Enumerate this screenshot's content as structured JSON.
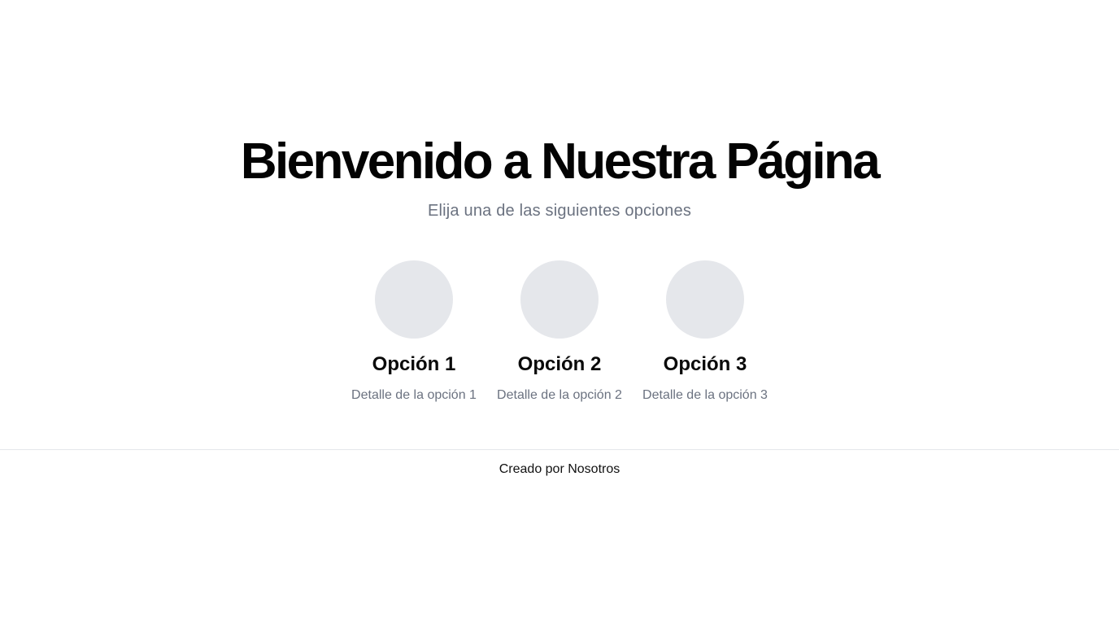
{
  "hero": {
    "title": "Bienvenido a Nuestra Página",
    "subtitle": "Elija una de las siguientes opciones"
  },
  "options": [
    {
      "title": "Opción 1",
      "detail": "Detalle de la opción 1"
    },
    {
      "title": "Opción 2",
      "detail": "Detalle de la opción 2"
    },
    {
      "title": "Opción 3",
      "detail": "Detalle de la opción 3"
    }
  ],
  "footer": {
    "text": "Creado por Nosotros"
  },
  "colors": {
    "circle": "#e5e7eb",
    "muted_text": "#6b7280",
    "divider": "#e5e7eb"
  }
}
